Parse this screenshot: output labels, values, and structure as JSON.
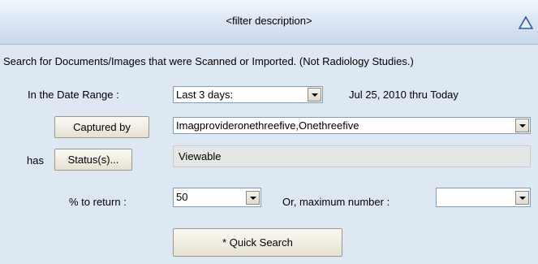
{
  "header": {
    "title": "<filter description>",
    "collapse_icon": "triangle-up-icon",
    "accent_color": "#2a5aa8"
  },
  "panel": {
    "description": "Search for Documents/Images that were Scanned or Imported.  (Not Radiology Studies.)",
    "date_range": {
      "label": "In the Date Range :",
      "selected": "Last 3 days:",
      "range_text": "Jul 25, 2010 thru Today"
    },
    "captured_by": {
      "button_label": "Captured by",
      "selected": "Imagprovideronethreefive,Onethreefive"
    },
    "status": {
      "prefix": "has",
      "button_label": "Status(s)...",
      "value": "Viewable"
    },
    "percent": {
      "label": "% to return :",
      "value": "50"
    },
    "maximum": {
      "label": "Or,  maximum number :",
      "value": ""
    },
    "quick_search": {
      "label": "* Quick Search"
    }
  }
}
